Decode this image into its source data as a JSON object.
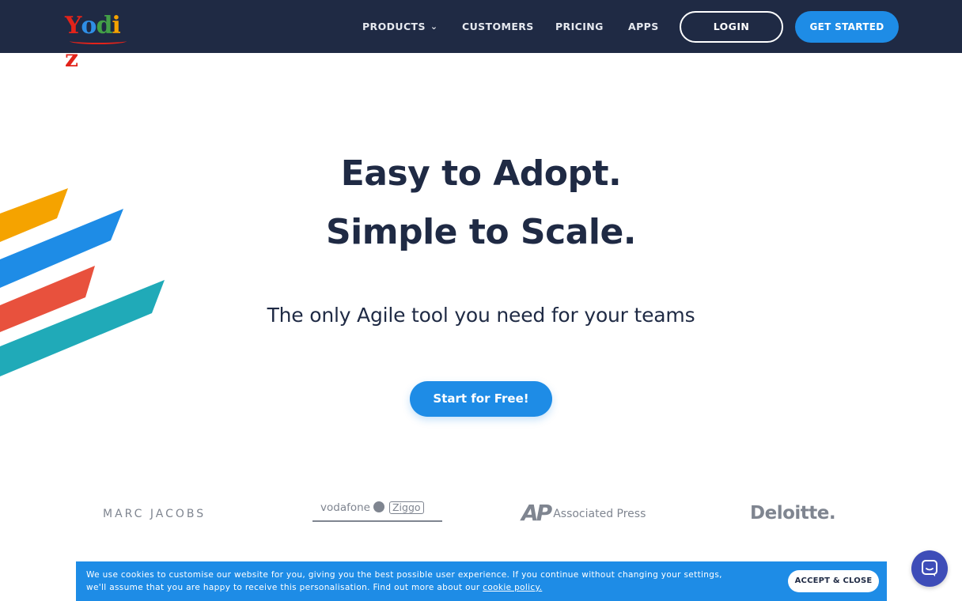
{
  "header": {
    "logo_letters": [
      {
        "char": "Y",
        "color": "#e2231a"
      },
      {
        "char": "o",
        "color": "#2f8ee6"
      },
      {
        "char": "d",
        "color": "#43a047"
      },
      {
        "char": "i",
        "color": "#f5a300"
      },
      {
        "char": "z",
        "color": "#e2231a"
      }
    ],
    "nav": {
      "products": "PRODUCTS",
      "customers": "CUSTOMERS",
      "pricing": "PRICING",
      "apps": "APPS"
    },
    "login": "LOGIN",
    "get_started": "GET STARTED",
    "background_color": "#1f2a44"
  },
  "hero": {
    "headline_line1": "Easy to Adopt.",
    "headline_line2": "Simple to Scale.",
    "subheadline": "The only Agile tool you need for your teams",
    "cta": "Start for Free!",
    "stripe_colors": [
      "#f5a300",
      "#1e8ce6",
      "#e8513d",
      "#20aab8"
    ]
  },
  "clients": {
    "marc_jacobs": "MARC JACOBS",
    "vodafone": "vodafone",
    "ziggo": "Ziggo",
    "ap_mark": "AP",
    "ap_name": "Associated Press",
    "deloitte": "Deloitte."
  },
  "cookie_banner": {
    "text_line1": "We use cookies to customise our website for you, giving you the best possible user experience. If you continue without changing your settings,",
    "text_line2": "we'll assume that you are happy to receive this personalisation. Find out more about our",
    "link": "cookie policy.",
    "accept": "ACCEPT & CLOSE"
  },
  "icons": {
    "chevron": "chevron-down-icon",
    "chat": "chat-icon"
  },
  "colors": {
    "accent": "#1e8ce6",
    "dark": "#1f2a44",
    "chat": "#3e4db8"
  }
}
